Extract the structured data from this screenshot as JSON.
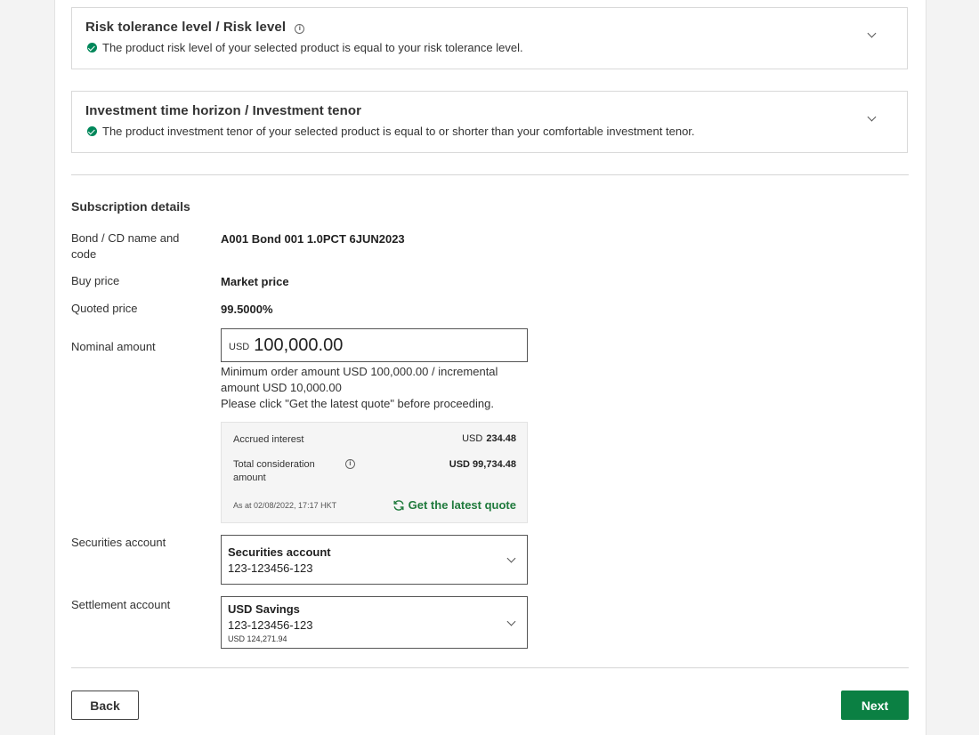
{
  "suitability": {
    "risk": {
      "title": "Risk tolerance level / Risk level",
      "message": "The product risk level of your selected product is equal to your risk tolerance level."
    },
    "tenor": {
      "title": "Investment time horizon / Investment tenor",
      "message": "The product investment tenor of your selected product is equal to or shorter than your comfortable investment tenor."
    }
  },
  "subscription": {
    "section_title": "Subscription details",
    "bond_label": "Bond / CD name and code",
    "bond_value": "A001 Bond 001 1.0PCT 6JUN2023",
    "buy_price_label": "Buy price",
    "buy_price_value": "Market price",
    "quoted_price_label": "Quoted price",
    "quoted_price_value": "99.5000%",
    "nominal_label": "Nominal amount",
    "nominal_currency": "USD",
    "nominal_amount": "100,000.00",
    "hint_line1": "Minimum order amount USD 100,000.00 / incremental amount USD 10,000.00",
    "hint_line2": "Please click \"Get the latest quote\" before proceeding."
  },
  "quote": {
    "accrued_label": "Accrued interest",
    "accrued_currency": "USD",
    "accrued_value": "234.48",
    "total_label": "Total consideration amount",
    "total_value": "USD 99,734.48",
    "as_at": "As at 02/08/2022, 17:17 HKT",
    "refresh_label": "Get the latest quote"
  },
  "securities_account": {
    "label": "Securities account",
    "selected_title": "Securities account",
    "selected_number": "123-123456-123"
  },
  "settlement_account": {
    "label": "Settlement account",
    "selected_title": "USD Savings",
    "selected_number": "123-123456-123",
    "selected_balance": "USD 124,271.94"
  },
  "actions": {
    "back": "Back",
    "next": "Next"
  },
  "colors": {
    "accent": "#0b8043",
    "success": "#00875a",
    "link": "#1f7a3c"
  }
}
